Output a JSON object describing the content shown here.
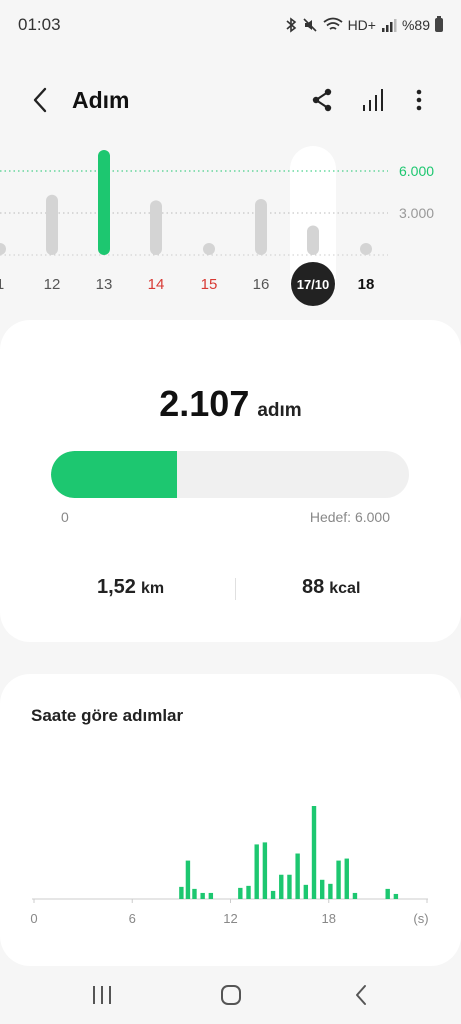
{
  "status_bar": {
    "time": "01:03",
    "network": "HD+",
    "battery": "%89",
    "icons": [
      "bluetooth-icon",
      "mute-icon",
      "wifi-icon",
      "signal-icon",
      "battery-icon"
    ]
  },
  "app_bar": {
    "title": "Adım",
    "icons": [
      "back-arrow-icon",
      "share-icon",
      "bar-chart-icon",
      "more-vert-icon"
    ]
  },
  "day_chart": {
    "days": [
      {
        "label": "1",
        "steps": 600,
        "color": "#555555"
      },
      {
        "label": "12",
        "steps": 4300,
        "color": "#555555"
      },
      {
        "label": "13",
        "steps": 7500,
        "color": "#555555"
      },
      {
        "label": "14",
        "steps": 3900,
        "color": "#d83a34"
      },
      {
        "label": "15",
        "steps": 600,
        "color": "#d83a34"
      },
      {
        "label": "16",
        "steps": 4000,
        "color": "#555555"
      },
      {
        "label": "17/10",
        "steps": 2107,
        "color": "#ffffff",
        "selected": true
      },
      {
        "label": "18",
        "steps": 600,
        "color": "#111111"
      }
    ],
    "goal_label": "6.000",
    "goal_value": 6000,
    "mid_label": "3.000",
    "mid_value": 3000,
    "goal_met_color": "#1dc770",
    "bar_color": "#d4d4d4"
  },
  "summary": {
    "steps": "2.107",
    "steps_unit": "adım",
    "progress_fraction": 0.351,
    "progress_min": "0",
    "progress_goal": "Hedef: 6.000",
    "distance": "1,52",
    "distance_unit": "km",
    "calories": "88",
    "calories_unit": "kcal",
    "accent": "#1dc770"
  },
  "hourly": {
    "title": "Saate göre adımlar",
    "x_ticks": [
      "0",
      "6",
      "12",
      "18"
    ],
    "x_unit": "(s)",
    "chart_data": {
      "type": "bar",
      "x": [
        9.0,
        9.4,
        9.8,
        10.3,
        10.8,
        12.6,
        13.1,
        13.6,
        14.1,
        14.6,
        15.1,
        15.6,
        16.1,
        16.6,
        17.1,
        17.6,
        18.1,
        18.6,
        19.1,
        19.6,
        20.1,
        21.6,
        22.1
      ],
      "values": [
        12,
        38,
        10,
        6,
        6,
        11,
        13,
        54,
        56,
        8,
        24,
        24,
        45,
        14,
        92,
        19,
        15,
        38,
        40,
        6,
        0,
        10,
        5
      ],
      "xlim": [
        0,
        24
      ],
      "bar_color": "#1dc770"
    }
  },
  "nav_bar": {
    "icons": [
      "recent-apps-icon",
      "home-icon",
      "back-icon"
    ]
  }
}
